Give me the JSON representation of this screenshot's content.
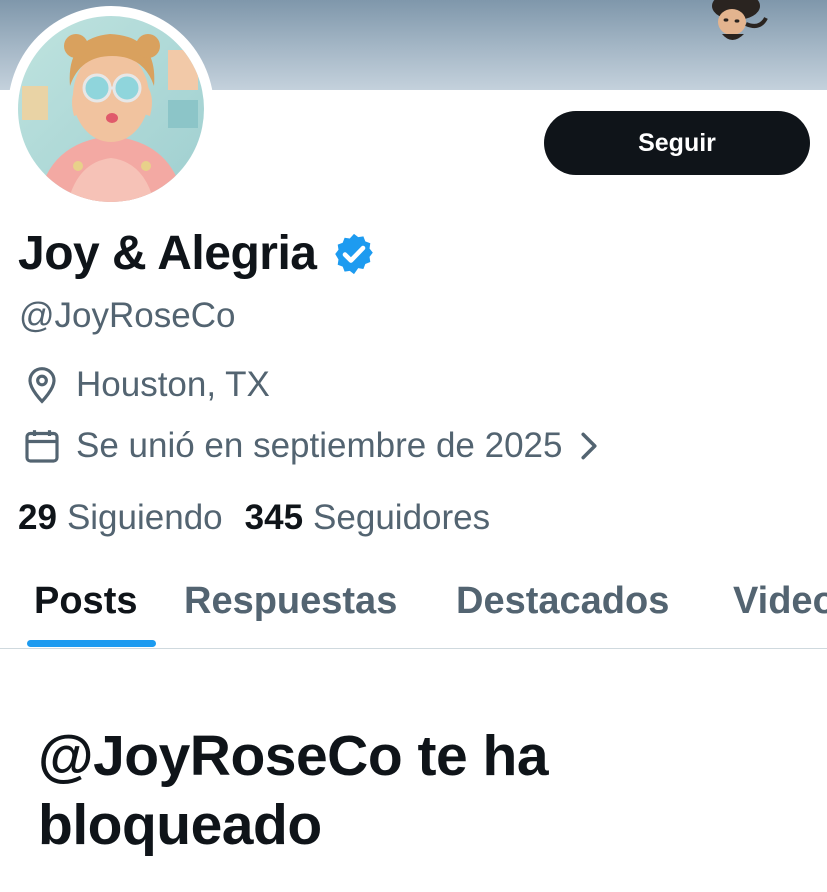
{
  "profile": {
    "display_name": "Joy & Alegria",
    "handle": "@JoyRoseCo",
    "location": "Houston, TX",
    "joined": "Se unió en septiembre de 2025",
    "verified_color": "#1d9bf0",
    "avatar_alt": "profile-photo"
  },
  "actions": {
    "follow_label": "Seguir"
  },
  "stats": {
    "following_count": "29",
    "following_label": "Siguiendo",
    "followers_count": "345",
    "followers_label": "Seguidores"
  },
  "tabs": [
    {
      "label": "Posts",
      "active": true
    },
    {
      "label": "Respuestas",
      "active": false
    },
    {
      "label": "Destacados",
      "active": false
    },
    {
      "label": "Videos",
      "active": false
    }
  ],
  "blocked": {
    "message": "@JoyRoseCo te ha bloqueado"
  },
  "icons": {
    "location": "map-pin-icon",
    "joined": "calendar-icon",
    "more": "chevron-right-icon",
    "verified": "verified-badge-icon"
  },
  "colors": {
    "text_primary": "#0f1419",
    "text_secondary": "#536471",
    "accent": "#1d9bf0",
    "button_bg": "#0f1419",
    "divider": "#cfd9de"
  }
}
